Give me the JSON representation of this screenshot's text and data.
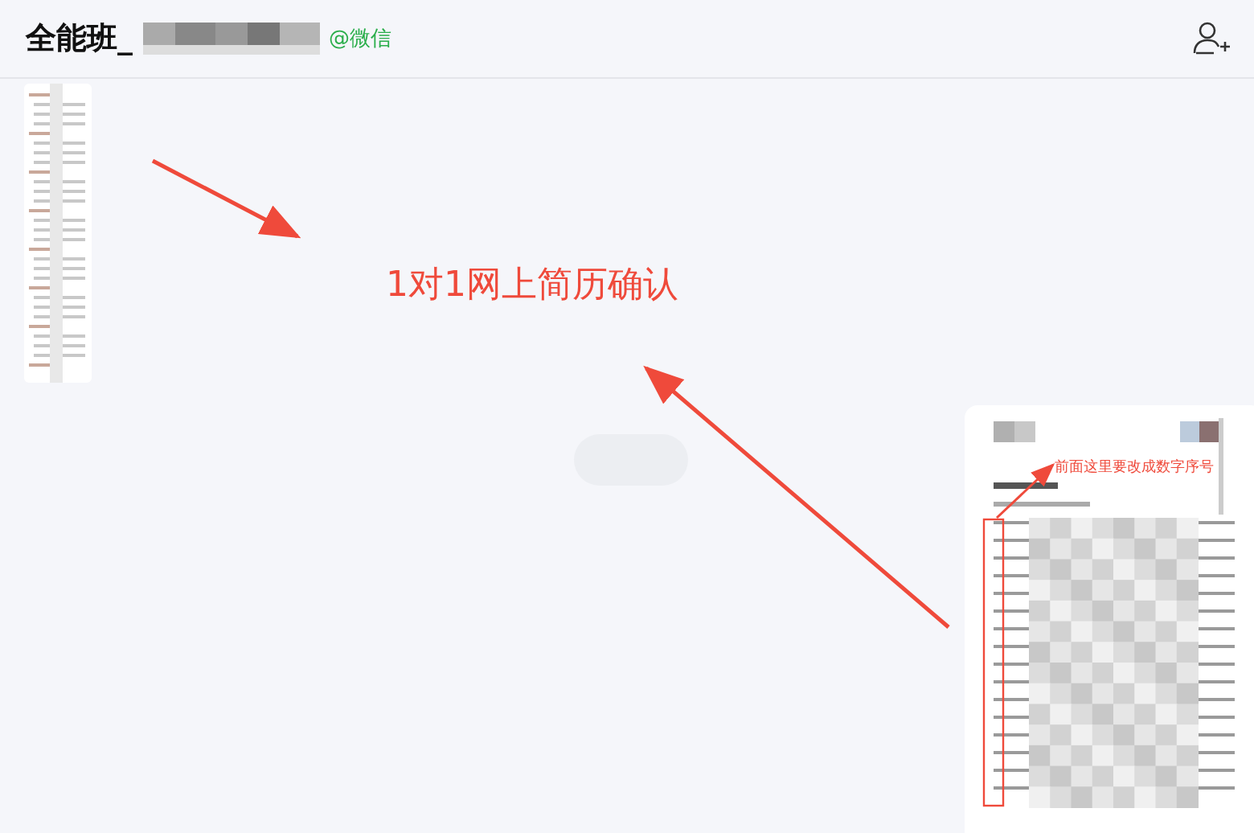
{
  "header": {
    "title": "全能班_",
    "mention": "@微信"
  },
  "annotations": [
    {
      "kind": "headline",
      "text": "1对1网上简历确认"
    },
    {
      "kind": "note",
      "text": "前面这里要改成数字序号"
    }
  ]
}
